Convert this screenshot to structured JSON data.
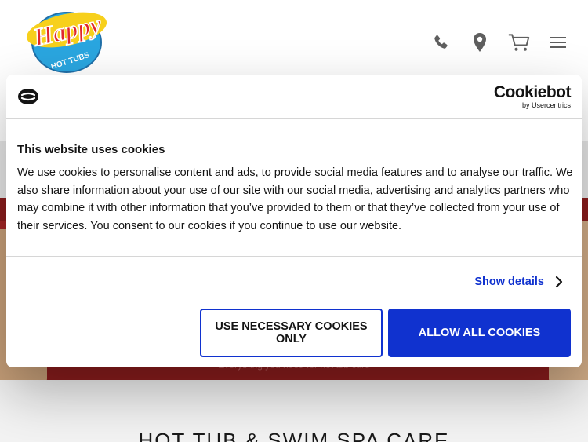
{
  "header": {
    "logo_text": "Happy",
    "logo_subtext": "HOT TUBS",
    "icons": [
      "phone-icon",
      "location-pin-icon",
      "cart-icon",
      "menu-icon"
    ]
  },
  "hero": {
    "faded_text": "Everything you need for hot tub care"
  },
  "section": {
    "title": "HOT TUB & SWIM SPA CARE"
  },
  "cookie_dialog": {
    "brand_name": "Cookiebot",
    "brand_sub": "by Usercentrics",
    "title": "This website uses cookies",
    "body": "We use cookies to personalise content and ads, to provide social media features and to analyse our traffic. We also share information about your use of our site with our social media, advertising and analytics partners who may combine it with other information that you’ve provided to them or that they’ve collected from your use of their services. You consent to our cookies if you continue to use our website.",
    "show_details_label": "Show details",
    "necessary_button_label": "USE NECESSARY COOKIES ONLY",
    "allow_all_button_label": "ALLOW ALL COOKIES"
  },
  "colors": {
    "accent_blue": "#1032cf",
    "logo_red": "#e0262b",
    "logo_blue": "#2aa6e0",
    "logo_yellow": "#f7d01c",
    "hero_red": "#8c1d1d"
  }
}
